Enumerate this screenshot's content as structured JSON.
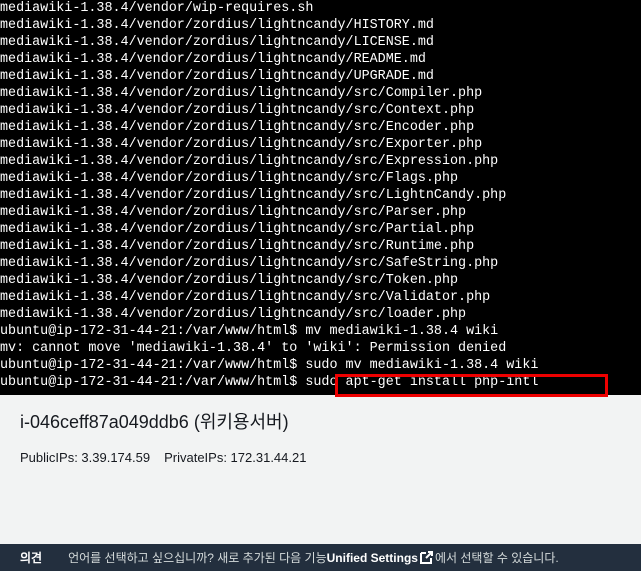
{
  "terminal": {
    "lines": [
      "mediawiki-1.38.4/vendor/wip-requires.sh",
      "mediawiki-1.38.4/vendor/zordius/lightncandy/HISTORY.md",
      "mediawiki-1.38.4/vendor/zordius/lightncandy/LICENSE.md",
      "mediawiki-1.38.4/vendor/zordius/lightncandy/README.md",
      "mediawiki-1.38.4/vendor/zordius/lightncandy/UPGRADE.md",
      "mediawiki-1.38.4/vendor/zordius/lightncandy/src/Compiler.php",
      "mediawiki-1.38.4/vendor/zordius/lightncandy/src/Context.php",
      "mediawiki-1.38.4/vendor/zordius/lightncandy/src/Encoder.php",
      "mediawiki-1.38.4/vendor/zordius/lightncandy/src/Exporter.php",
      "mediawiki-1.38.4/vendor/zordius/lightncandy/src/Expression.php",
      "mediawiki-1.38.4/vendor/zordius/lightncandy/src/Flags.php",
      "mediawiki-1.38.4/vendor/zordius/lightncandy/src/LightnCandy.php",
      "mediawiki-1.38.4/vendor/zordius/lightncandy/src/Parser.php",
      "mediawiki-1.38.4/vendor/zordius/lightncandy/src/Partial.php",
      "mediawiki-1.38.4/vendor/zordius/lightncandy/src/Runtime.php",
      "mediawiki-1.38.4/vendor/zordius/lightncandy/src/SafeString.php",
      "mediawiki-1.38.4/vendor/zordius/lightncandy/src/Token.php",
      "mediawiki-1.38.4/vendor/zordius/lightncandy/src/Validator.php",
      "mediawiki-1.38.4/vendor/zordius/lightncandy/src/loader.php",
      "ubuntu@ip-172-31-44-21:/var/www/html$ mv mediawiki-1.38.4 wiki",
      "mv: cannot move 'mediawiki-1.38.4' to 'wiki': Permission denied",
      "ubuntu@ip-172-31-44-21:/var/www/html$ sudo mv mediawiki-1.38.4 wiki",
      "ubuntu@ip-172-31-44-21:/var/www/html$ sudo apt-get install php-intl"
    ],
    "highlight_color": "#ee0000"
  },
  "instance": {
    "title": "i-046ceff87a049ddb6 (위키용서버)",
    "public_ips": "PublicIPs: 3.39.174.59",
    "private_ips": "PrivateIPs: 172.31.44.21"
  },
  "footer": {
    "feedback": "의견",
    "message_pre": "언어를 선택하고 싶으십니까? 새로 추가된 다음 기능",
    "link": "Unified Settings",
    "message_post": "에서 선택할 수 있습니다."
  }
}
